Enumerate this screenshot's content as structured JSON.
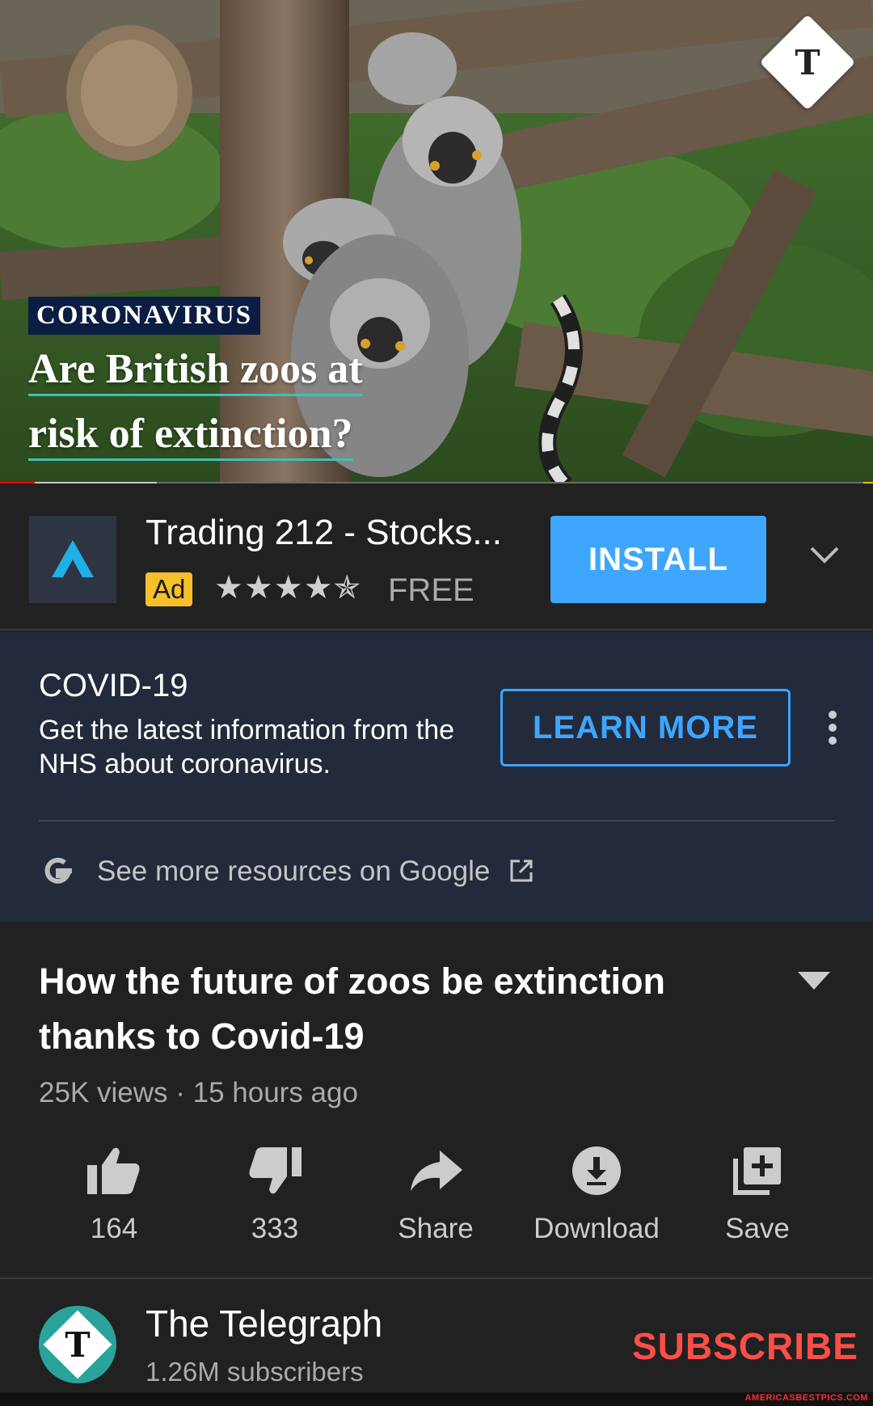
{
  "video": {
    "kicker": "CORONAVIRUS",
    "headline_line1": "Are British zoos at",
    "headline_line2": "risk of extinction?",
    "channel_badge_glyph": "ᵗ",
    "progress_played": 0.04,
    "progress_buffered": 0.18
  },
  "ad": {
    "title": "Trading 212 - Stocks...",
    "badge": "Ad",
    "stars": "★★★★✯",
    "rating": 4.5,
    "price": "FREE",
    "install_label": "INSTALL",
    "accent": "#3ea6ff"
  },
  "covid_panel": {
    "title": "COVID-19",
    "body": "Get the latest information from the NHS about coronavirus.",
    "learn_more_label": "LEARN MORE",
    "resources_link": "See more resources on Google",
    "background": "#232a3b"
  },
  "video_info": {
    "title": "How the future of zoos be extinction thanks to Covid-19",
    "meta": "25K views · 15 hours ago",
    "actions": [
      {
        "icon": "thumbs-up-icon",
        "label": "164"
      },
      {
        "icon": "thumbs-down-icon",
        "label": "333"
      },
      {
        "icon": "share-icon",
        "label": "Share"
      },
      {
        "icon": "download-icon",
        "label": "Download"
      },
      {
        "icon": "save-icon",
        "label": "Save"
      }
    ]
  },
  "channel": {
    "name": "The Telegraph",
    "subscribers": "1.26M subscribers",
    "subscribe_label": "SUBSCRIBE",
    "subscribe_color": "#ff4e45"
  },
  "watermark": "AMERICASBESTPICS.COM"
}
